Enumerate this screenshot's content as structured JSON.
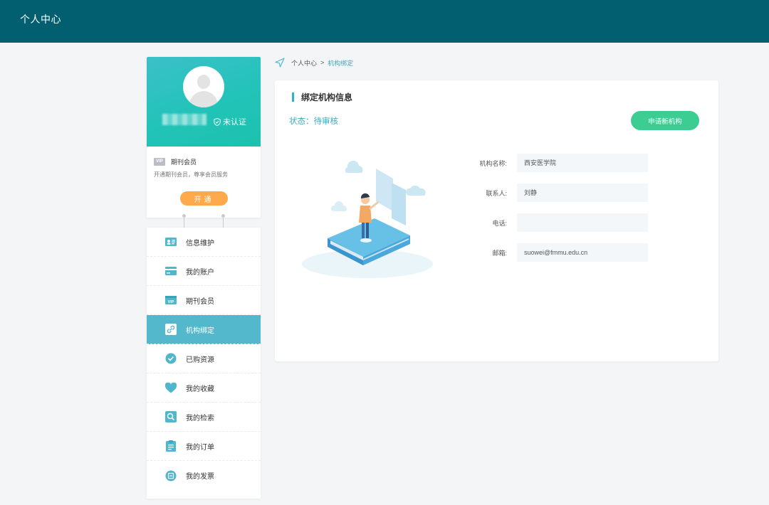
{
  "header": {
    "title": "个人中心"
  },
  "profile": {
    "verify_status": "未认证",
    "vip_label": "期刊会员",
    "vip_badge": "VIP",
    "vip_desc": "开通期刊会员，尊享会员服务",
    "open_button": "开通"
  },
  "menu": {
    "items": [
      {
        "label": "信息维护",
        "icon": "id-card-icon"
      },
      {
        "label": "我的账户",
        "icon": "credit-card-icon"
      },
      {
        "label": "期刊会员",
        "icon": "vip-icon"
      },
      {
        "label": "机构绑定",
        "icon": "link-icon",
        "active": true
      },
      {
        "label": "已购资源",
        "icon": "check-circle-icon"
      },
      {
        "label": "我的收藏",
        "icon": "heart-icon"
      },
      {
        "label": "我的检索",
        "icon": "search-icon"
      },
      {
        "label": "我的订单",
        "icon": "order-icon"
      },
      {
        "label": "我的发票",
        "icon": "invoice-icon"
      }
    ]
  },
  "breadcrumb": {
    "root": "个人中心",
    "separator": ">",
    "current": "机构绑定"
  },
  "card": {
    "title": "绑定机构信息",
    "status": "状态：待审核",
    "apply_button": "申请新机构",
    "fields": [
      {
        "label": "机构名称:",
        "value": "西安医学院"
      },
      {
        "label": "联系人:",
        "value": "刘静"
      },
      {
        "label": "电话:",
        "value": ""
      },
      {
        "label": "邮箱:",
        "value": "suowei@fmmu.edu.cn"
      }
    ]
  },
  "colors": {
    "topbar": "#015f6f",
    "accent": "#53b8cc",
    "apply_button": "#3ccd93",
    "open_button": "#ffa94d",
    "status_text": "#3eaabf"
  }
}
